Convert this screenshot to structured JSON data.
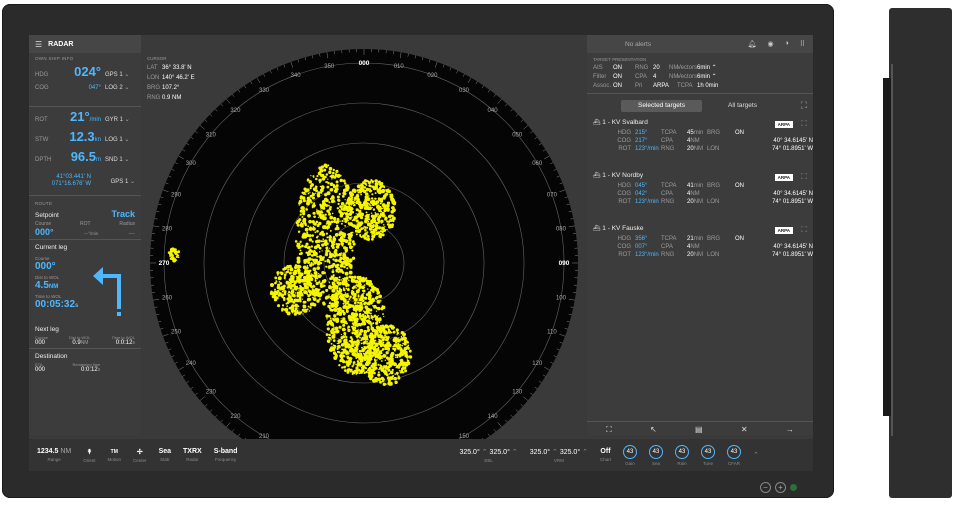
{
  "app": {
    "title": "RADAR"
  },
  "own_ship": {
    "header": "OWN SHIP INFO",
    "rows": [
      {
        "label": "HDG",
        "value": "024°",
        "unit": "",
        "source": "GPS 1"
      },
      {
        "label": "COG",
        "value": "047°",
        "unit": "",
        "source": "LOG 2"
      },
      {
        "label": "ROT",
        "value": "21°",
        "unit": "/min",
        "source": "GYR 1"
      },
      {
        "label": "STW",
        "value": "12.3",
        "unit": "kn",
        "source": "LOG 1"
      },
      {
        "label": "DPTH",
        "value": "96.5",
        "unit": "m",
        "source": "SND 1"
      }
    ],
    "lat": "41°03.441' N",
    "lon": "071°16.676' W",
    "pos_source": "GPS 1"
  },
  "route": {
    "header": "ROUTE",
    "setpoint": "Setpoint",
    "mode": "Track",
    "course_label": "Course",
    "rot_label": "ROT",
    "radius_label": "Radius",
    "course": "000°",
    "rot": "---°/min",
    "radius": "----",
    "current_leg": "Current leg",
    "cl_course_label": "Course",
    "cl_course": "000°",
    "dist_label": "Dist to WOL",
    "dist": "4.5",
    "dist_unit": "NM",
    "time_label": "Time to WOL",
    "time": "00:05:32",
    "time_unit": "s",
    "next_leg": "Next leg",
    "nl_course_label": "Course",
    "nl_dist_label": "Dist to WOL",
    "nl_time_label": "Time to WOL",
    "nl_course": "000",
    "nl_dist": "0.9",
    "nl_dist_unit": "NM",
    "nl_time": "0:0:12",
    "nl_time_unit": "s",
    "destination": "Destination",
    "eta_label": "ETA",
    "remaining_label": "Remaining time",
    "eta": "000",
    "remaining": "0:0:12",
    "remaining_unit": "s"
  },
  "cursor": {
    "header": "CURSOR",
    "lat_label": "LAT",
    "lat": "36° 33.8' N",
    "lon_label": "LON",
    "lon": "140° 46.2' E",
    "brg_label": "BRG",
    "brg": "107.2°",
    "rng_label": "RNG",
    "rng": "0.9 NM"
  },
  "bearings": [
    "000",
    "010",
    "020",
    "030",
    "040",
    "050",
    "060",
    "070",
    "080",
    "090",
    "100",
    "110",
    "120",
    "130",
    "140",
    "150",
    "160",
    "170",
    "180",
    "190",
    "200",
    "210",
    "220",
    "230",
    "240",
    "250",
    "260",
    "270",
    "280",
    "290",
    "300",
    "310",
    "320",
    "330",
    "340",
    "350"
  ],
  "alerts": {
    "text": "No alerts"
  },
  "target_presentation": {
    "header": "TARGET PRESENTATION",
    "rows": [
      [
        "AIS",
        "ON",
        "RNG",
        "20",
        "NM",
        "Vectors",
        "6min ⌃"
      ],
      [
        "Filter",
        "ON",
        "CPA",
        "4",
        "NM",
        "Vectors",
        "6min ⌃"
      ],
      [
        "Assoc.",
        "ON",
        "Pri",
        "ARPA",
        "",
        "TCPA",
        "1h 0min"
      ]
    ]
  },
  "tabs": {
    "selected": "Selected targets",
    "all": "All targets"
  },
  "targets": [
    {
      "name": "1 - KV Svalbard",
      "badge": "ARPA",
      "hdg": "215°",
      "cog": "217°",
      "rot": "123°/min",
      "tcpa": "45",
      "cpa": "4",
      "rng": "20",
      "brg": "ON",
      "lat": "40° 34.6145' N",
      "lon": "74° 01.8951' W"
    },
    {
      "name": "1 - KV Nordby",
      "badge": "ARPA",
      "hdg": "045°",
      "cog": "042°",
      "rot": "123°/min",
      "tcpa": "41",
      "cpa": "4",
      "rng": "20",
      "brg": "ON",
      "lat": "40° 34.6145' N",
      "lon": "74° 01.8951' W"
    },
    {
      "name": "1 - KV Fauske",
      "badge": "ARPA",
      "hdg": "356°",
      "cog": "007°",
      "rot": "123°/min",
      "tcpa": "21",
      "cpa": "4",
      "rng": "20",
      "brg": "ON",
      "lat": "40° 34.6145' N",
      "lon": "74° 01.8951' W"
    }
  ],
  "target_labels": {
    "hdg": "HDG",
    "cog": "COG",
    "rot": "ROT",
    "tcpa": "TCPA",
    "cpa": "CPA",
    "rng": "RNG",
    "brg": "BRG",
    "lon": "LON",
    "min": "min",
    "nm": "NM"
  },
  "bottom": {
    "range": "1234.5",
    "range_unit": "NM",
    "range_label": "Range",
    "orient_label": "Orient",
    "motion": "TM",
    "motion_label": "Motion",
    "center_label": "Center",
    "stab": "Sea",
    "stab_label": "Stab",
    "radar": "TXRX",
    "radar_label": "Radar",
    "freq": "S-band",
    "freq_label": "Frequency",
    "ebl1": "325.0°",
    "ebl2": "325.0°",
    "ebl_label": "EBL",
    "vrm1": "325.0°",
    "vrm2": "325.0°",
    "vrm_label": "VRM",
    "chart": "Off",
    "chart_label": "Chart",
    "knobs": [
      {
        "v": "43",
        "l": "Gain"
      },
      {
        "v": "43",
        "l": "Sea"
      },
      {
        "v": "43",
        "l": "Rain"
      },
      {
        "v": "43",
        "l": "Tune"
      },
      {
        "v": "43",
        "l": "CFAR"
      }
    ]
  },
  "colors": {
    "accent": "#4db8ff",
    "echo": "#f5f500"
  }
}
